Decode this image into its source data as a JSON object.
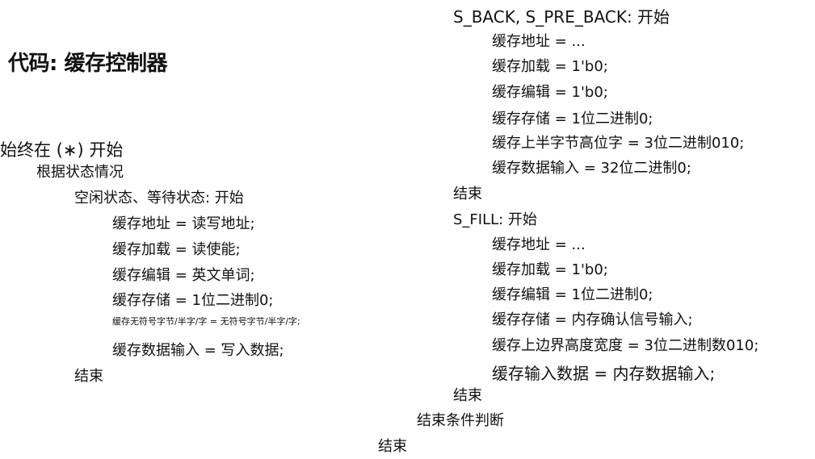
{
  "title": "代码: 缓存控制器",
  "left": {
    "always": "始终在 (∗) 开始",
    "case": "根据状态情况",
    "idle": "空闲状态、等待状态: 开始",
    "idle_lines": [
      "缓存地址 = 读写地址;",
      "缓存加载 = 读使能;",
      "缓存编辑 = 英文单词;",
      "缓存存储 = 1位二进制0;",
      "缓存无符号字节/半字/字 = 无符号字节/半字/字;",
      "缓存数据输入 = 写入数据;"
    ],
    "end": "结束"
  },
  "right": {
    "back_header": "S_BACK, S_PRE_BACK: 开始",
    "back_lines": [
      "缓存地址 = ...",
      "缓存加载 = 1'b0;",
      "缓存编辑 = 1'b0;",
      "缓存存储 = 1位二进制0;",
      "缓存上半字节高位字 = 3位二进制010;",
      "缓存数据输入 = 32位二进制0;"
    ],
    "back_end": "结束",
    "fill_header": "S_FILL: 开始",
    "fill_lines": [
      "缓存地址 = ...",
      "缓存加载 = 1'b0;",
      "缓存编辑 = 1位二进制0;",
      "缓存存储 = 内存确认信号输入;",
      "缓存上边界高度宽度 = 3位二进制数010;",
      "缓存输入数据 = 内存数据输入;"
    ],
    "fill_end": "结束",
    "endcase": "结束条件判断",
    "end": "结束"
  }
}
